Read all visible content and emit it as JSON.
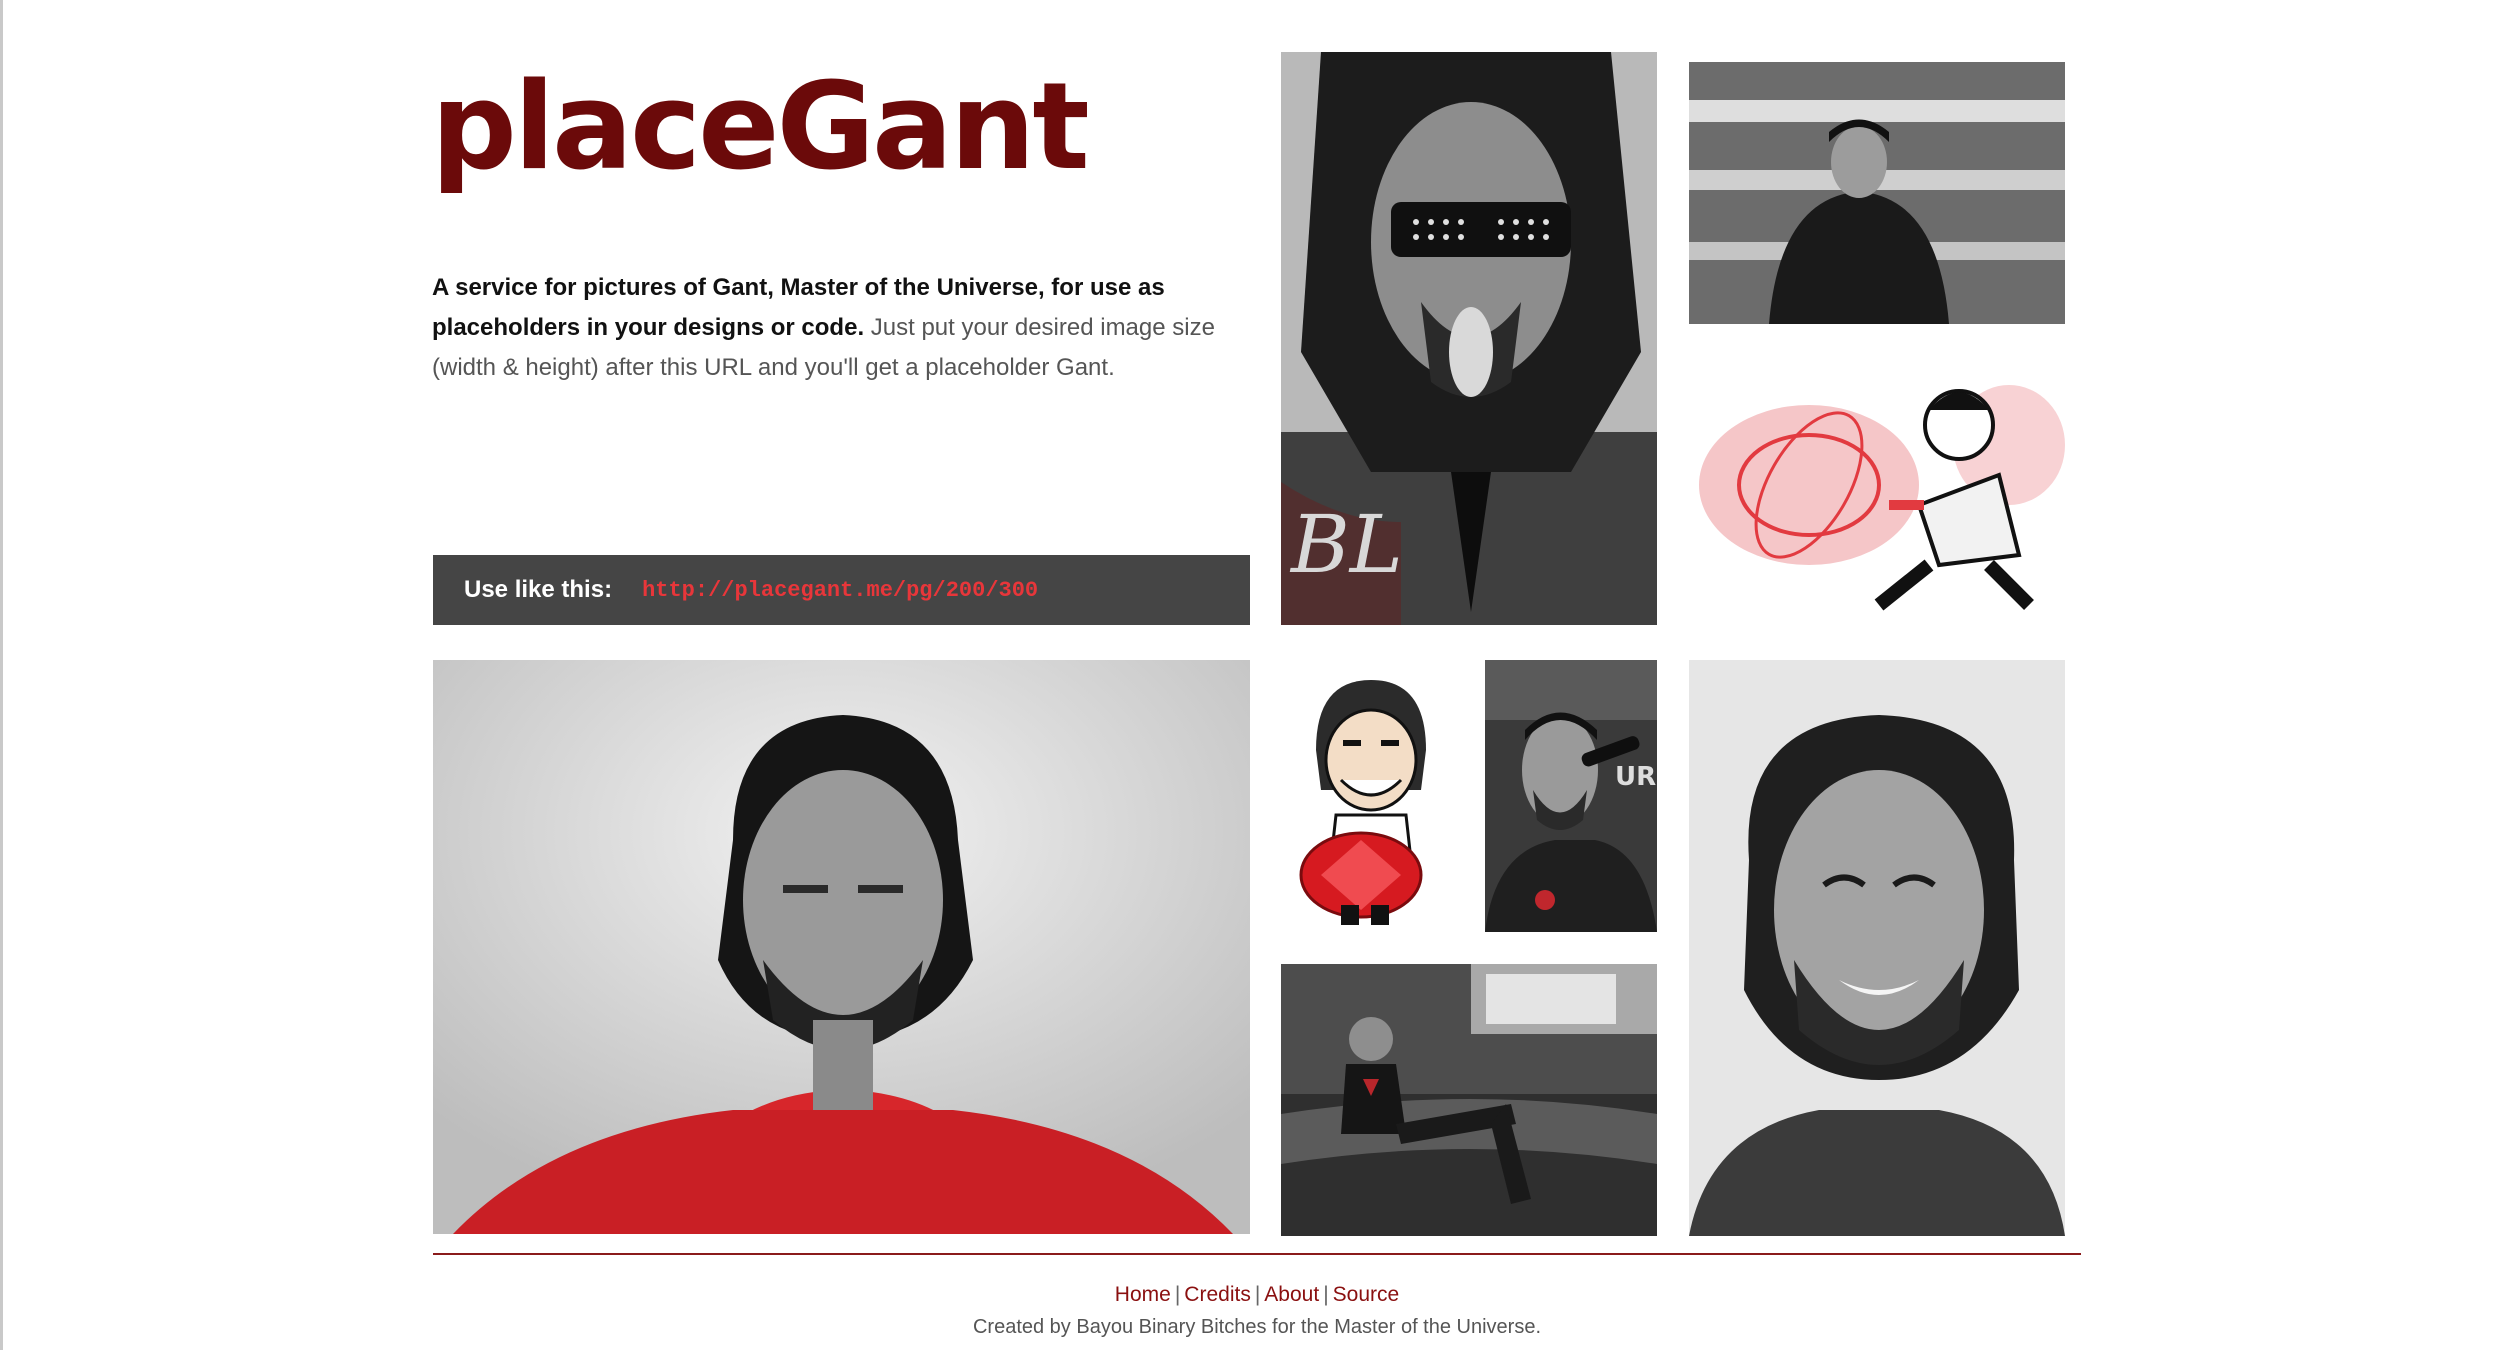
{
  "site": {
    "logo": "placeGant",
    "intro_bold": "A service for pictures of Gant, Master of the Universe, for use as placeholders in your designs or code.",
    "intro_rest": " Just put your desired image size (width & height) after this URL and you'll get a placeholder Gant."
  },
  "usage": {
    "label": "Use like this:",
    "url": "http://placegant.me/pg/200/300"
  },
  "photos": [
    {
      "name": "photo-gant-shutter-shades",
      "subject": "grayscale portrait, shutter shades, tongue out"
    },
    {
      "name": "photo-gant-on-stage",
      "subject": "grayscale, man in dark suit, striped lights"
    },
    {
      "name": "photo-gant-cartoon-energy",
      "subject": "cartoon with red energy aura"
    },
    {
      "name": "photo-gant-red-shirt",
      "subject": "grayscale portrait, red shirt"
    },
    {
      "name": "photo-gant-caricature-gem",
      "subject": "caricature holding red gem"
    },
    {
      "name": "photo-gant-microphone",
      "subject": "grayscale, singing at microphone"
    },
    {
      "name": "photo-gant-couch",
      "subject": "grayscale, lounging on couch"
    },
    {
      "name": "photo-gant-smiling",
      "subject": "grayscale portrait, smiling"
    }
  ],
  "footer": {
    "links": [
      "Home",
      "Credits",
      "About",
      "Source"
    ],
    "separator": "|",
    "credit": "Created by Bayou Binary Bitches for the Master of the Universe."
  },
  "colors": {
    "brand": "#6b0a0a",
    "link": "#8a1010",
    "usage_bar": "#454545",
    "usage_url": "#e8363a",
    "accent_red": "#d7262b"
  }
}
